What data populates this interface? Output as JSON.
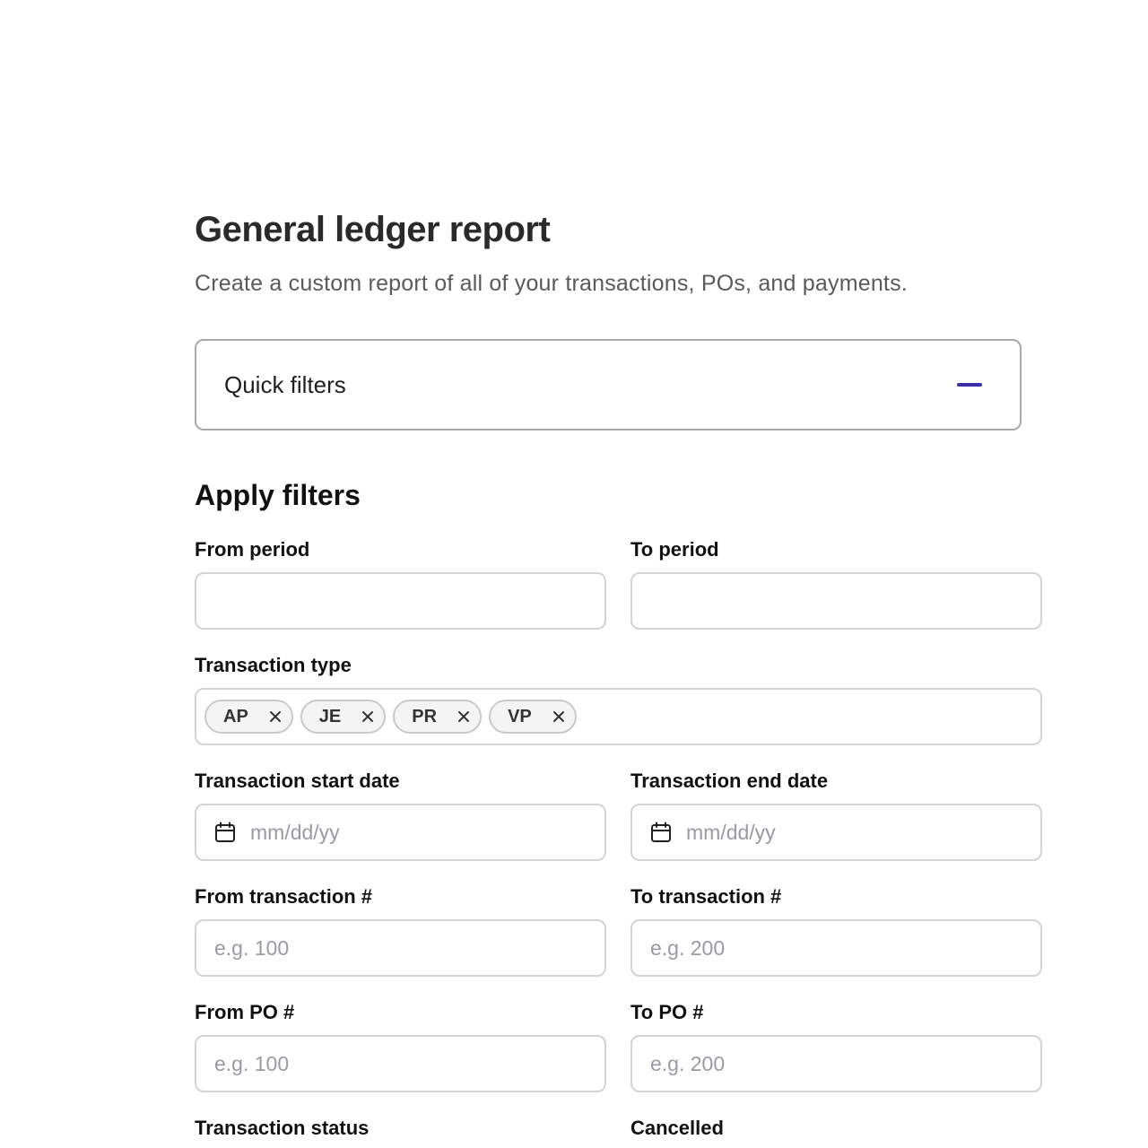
{
  "header": {
    "title": "General ledger report",
    "subtitle": "Create a custom report of all of your transactions, POs, and payments."
  },
  "quick_filters": {
    "label": "Quick filters"
  },
  "filters": {
    "heading": "Apply filters",
    "from_period": {
      "label": "From period",
      "value": ""
    },
    "to_period": {
      "label": "To period",
      "value": ""
    },
    "transaction_type": {
      "label": "Transaction type",
      "chips": [
        "AP",
        "JE",
        "PR",
        "VP"
      ]
    },
    "start_date": {
      "label": "Transaction start date",
      "placeholder": "mm/dd/yy"
    },
    "end_date": {
      "label": "Transaction end date",
      "placeholder": "mm/dd/yy"
    },
    "from_transaction": {
      "label": "From transaction #",
      "placeholder": "e.g. 100"
    },
    "to_transaction": {
      "label": "To transaction #",
      "placeholder": "e.g. 200"
    },
    "from_po": {
      "label": "From PO #",
      "placeholder": "e.g. 100"
    },
    "to_po": {
      "label": "To PO #",
      "placeholder": "e.g. 200"
    },
    "transaction_status": {
      "label": "Transaction status"
    },
    "cancelled": {
      "label": "Cancelled"
    }
  }
}
